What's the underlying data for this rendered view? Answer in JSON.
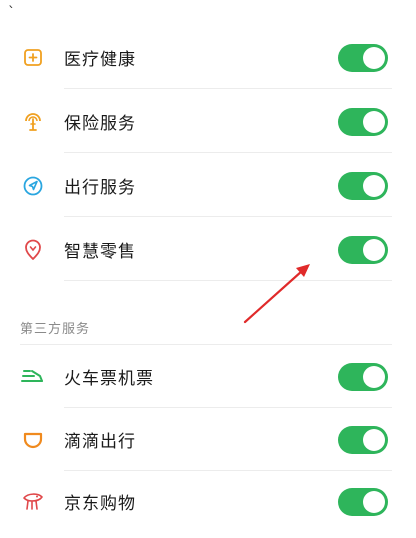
{
  "stray_mark": "`",
  "colors": {
    "toggle_on": "#2eb55b",
    "annotation_arrow": "#e02a2a"
  },
  "system_services": [
    {
      "label": "医疗健康",
      "icon": "medical-plus-icon",
      "icon_color": "#f0a020",
      "enabled": true
    },
    {
      "label": "保险服务",
      "icon": "insurance-umbrella-icon",
      "icon_color": "#f0a020",
      "enabled": true
    },
    {
      "label": "出行服务",
      "icon": "travel-navigation-icon",
      "icon_color": "#2aa6e0",
      "enabled": true
    },
    {
      "label": "智慧零售",
      "icon": "retail-location-icon",
      "icon_color": "#e0484a",
      "enabled": true
    }
  ],
  "third_party": {
    "header": "第三方服务",
    "items": [
      {
        "label": "火车票机票",
        "icon": "train-ticket-icon",
        "icon_color": "#2eb55b",
        "enabled": true
      },
      {
        "label": "滴滴出行",
        "icon": "didi-icon",
        "icon_color": "#f08a1e",
        "enabled": true
      },
      {
        "label": "京东购物",
        "icon": "jd-dog-icon",
        "icon_color": "#e0484a",
        "enabled": true
      }
    ]
  }
}
